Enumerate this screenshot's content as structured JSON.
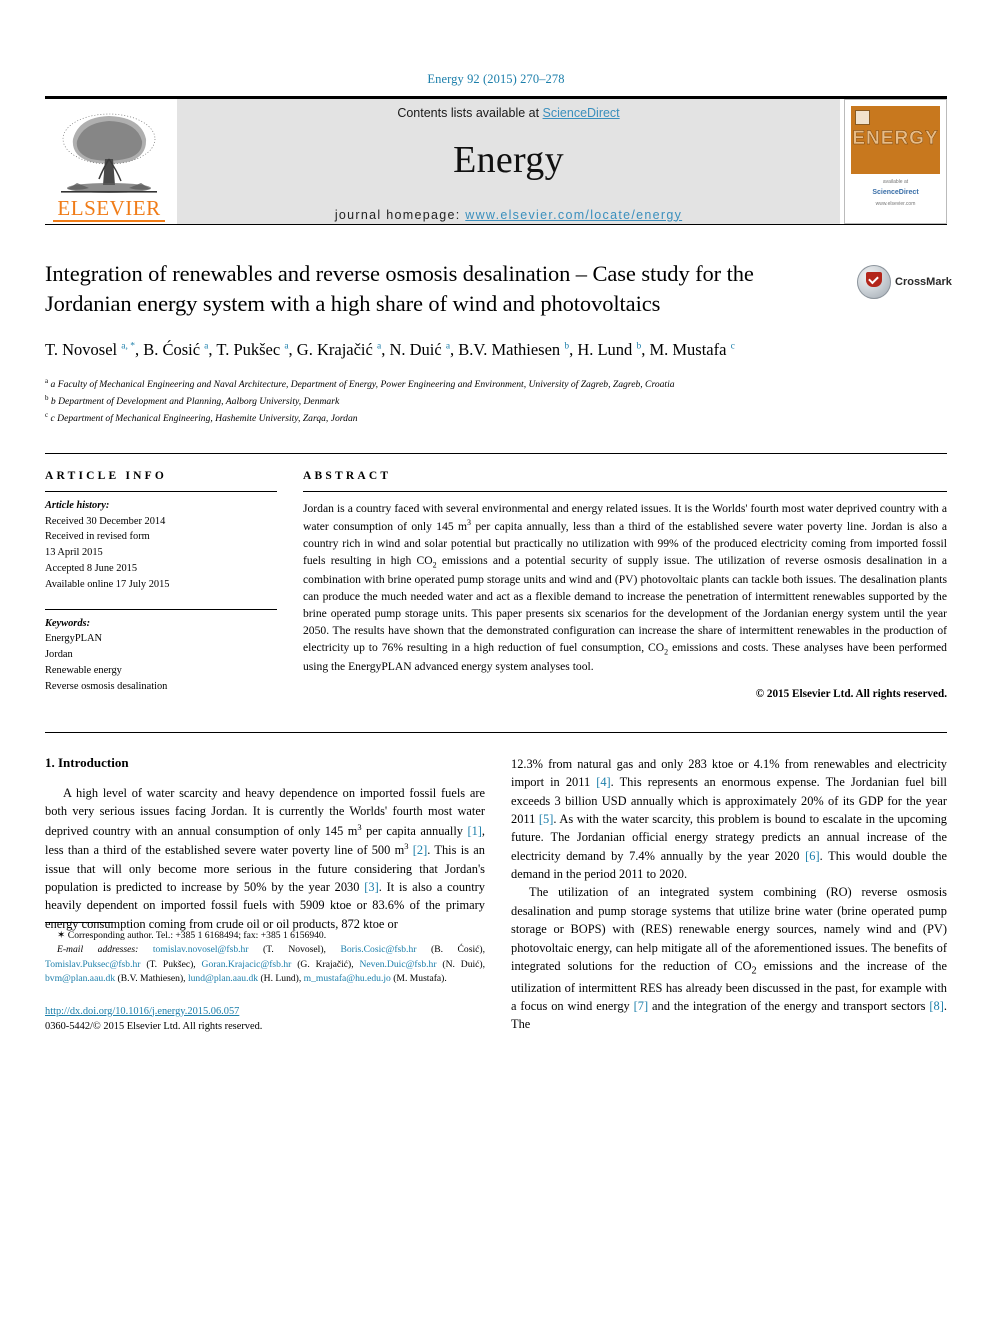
{
  "running_head": "Energy 92 (2015) 270–278",
  "masthead": {
    "contents_prefix": "Contents lists available at ",
    "sciencedirect": "ScienceDirect",
    "journal_title": "Energy",
    "homepage_label": "journal homepage:",
    "homepage_url": "www.elsevier.com/locate/energy",
    "publisher_logo_text": "ELSEVIER",
    "cover_band_text": "ENERGY"
  },
  "article": {
    "title": "Integration of renewables and reverse osmosis desalination – Case study for the Jordanian energy system with a high share of wind and photovoltaics",
    "crossmark_label": "CrossMark",
    "authors_html": "T. Novosel <sup>a, *</sup>, B. Ćosić <sup>a</sup>, T. Pukšec <sup>a</sup>, G. Krajačić <sup>a</sup>, N. Duić <sup>a</sup>, B.V. Mathiesen <sup>b</sup>, H. Lund <sup>b</sup>, M. Mustafa <sup>c</sup>",
    "affiliations": [
      "a Faculty of Mechanical Engineering and Naval Architecture, Department of Energy, Power Engineering and Environment, University of Zagreb, Zagreb, Croatia",
      "b Department of Development and Planning, Aalborg University, Denmark",
      "c Department of Mechanical Engineering, Hashemite University, Zarqa, Jordan"
    ]
  },
  "article_info": {
    "heading": "ARTICLE INFO",
    "history_label": "Article history:",
    "history_lines": [
      "Received 30 December 2014",
      "Received in revised form",
      "13 April 2015",
      "Accepted 8 June 2015",
      "Available online 17 July 2015"
    ],
    "keywords_label": "Keywords:",
    "keywords": [
      "EnergyPLAN",
      "Jordan",
      "Renewable energy",
      "Reverse osmosis desalination"
    ]
  },
  "abstract": {
    "heading": "ABSTRACT",
    "text_html": "Jordan is a country faced with several environmental and energy related issues. It is the Worlds' fourth most water deprived country with a water consumption of only 145 m<sup>3</sup> per capita annually, less than a third of the established severe water poverty line. Jordan is also a country rich in wind and solar potential but practically no utilization with 99% of the produced electricity coming from imported fossil fuels resulting in high CO<sub>2</sub> emissions and a potential security of supply issue. The utilization of reverse osmosis desalination in a combination with brine operated pump storage units and wind and (PV) photovoltaic plants can tackle both issues. The desalination plants can produce the much needed water and act as a flexible demand to increase the penetration of intermittent renewables supported by the brine operated pump storage units. This paper presents six scenarios for the development of the Jordanian energy system until the year 2050. The results have shown that the demonstrated configuration can increase the share of intermittent renewables in the production of electricity up to 76% resulting in a high reduction of fuel consumption, CO<sub>2</sub> emissions and costs. These analyses have been performed using the EnergyPLAN advanced energy system analyses tool.",
    "copyright": "© 2015 Elsevier Ltd. All rights reserved."
  },
  "body": {
    "section_heading": "1. Introduction",
    "left_paragraph_html": "A high level of water scarcity and heavy dependence on imported fossil fuels are both very serious issues facing Jordan. It is currently the Worlds' fourth most water deprived country with an annual consumption of only 145 m<sup>3</sup> per capita annually <span class=\"ref\">[1]</span>, less than a third of the established severe water poverty line of 500 m<sup>3</sup> <span class=\"ref\">[2]</span>. This is an issue that will only become more serious in the future considering that Jordan's population is predicted to increase by 50% by the year 2030 <span class=\"ref\">[3]</span>. It is also a country heavily dependent on imported fossil fuels with 5909 ktoe or 83.6% of the primary energy consumption coming from crude oil or oil products, 872 ktoe or",
    "right_paragraph_1_html": "12.3% from natural gas and only 283 ktoe or 4.1% from renewables and electricity import in 2011 <span class=\"ref\">[4]</span>. This represents an enormous expense. The Jordanian fuel bill exceeds 3 billion USD annually which is approximately 20% of its GDP for the year 2011 <span class=\"ref\">[5]</span>. As with the water scarcity, this problem is bound to escalate in the upcoming future. The Jordanian official energy strategy predicts an annual increase of the electricity demand by 7.4% annually by the year 2020 <span class=\"ref\">[6]</span>. This would double the demand in the period 2011 to 2020.",
    "right_paragraph_2_html": "The utilization of an integrated system combining (RO) reverse osmosis desalination and pump storage systems that utilize brine water (brine operated pump storage or BOPS) with (RES) renewable energy sources, namely wind and (PV) photovoltaic energy, can help mitigate all of the aforementioned issues. The benefits of integrated solutions for the reduction of CO<sub>2</sub> emissions and the increase of the utilization of intermittent RES has already been discussed in the past, for example with a focus on wind energy <span class=\"ref\">[7]</span> and the integration of the energy and transport sectors <span class=\"ref\">[8]</span>. The"
  },
  "footnotes": {
    "corresponding_html": "<span style=\"font-size:10px\">✶</span> Corresponding author. Tel.: +385 1 6168494; fax: +385 1 6156940.",
    "emails_html": "<span class=\"em\">E-mail addresses:</span> <span class=\"fn-link\">tomislav.novosel@fsb.hr</span> (T. Novosel), <span class=\"fn-link\">Boris.Cosic@fsb.hr</span> (B. Ćosić), <span class=\"fn-link\">Tomislav.Puksec@fsb.hr</span> (T. Pukšec), <span class=\"fn-link\">Goran.Krajacic@fsb.hr</span> (G. Krajačić), <span class=\"fn-link\">Neven.Duic@fsb.hr</span> (N. Duić), <span class=\"fn-link\">bvm@plan.aau.dk</span> (B.V. Mathiesen), <span class=\"fn-link\">lund@plan.aau.dk</span> (H. Lund), <span class=\"fn-link\">m_mustafa@hu.edu.jo</span> (M. Mustafa).",
    "doi": "http://dx.doi.org/10.1016/j.energy.2015.06.057",
    "issn_line": "0360-5442/© 2015 Elsevier Ltd. All rights reserved."
  },
  "colors": {
    "link_blue": "#1b7eaa",
    "elsevier_orange": "#f07c18",
    "masthead_gray": "#e3e3e3",
    "cover_orange": "#c8781e"
  }
}
